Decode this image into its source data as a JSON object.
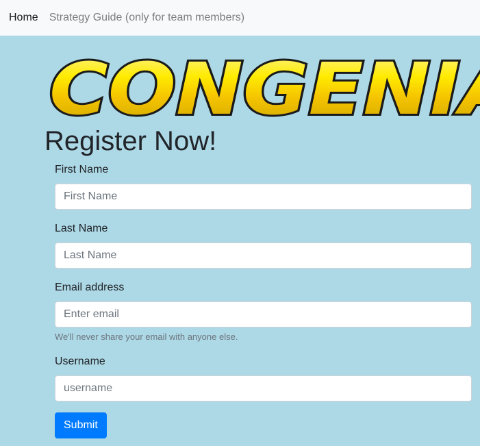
{
  "navbar": {
    "links": [
      {
        "label": "Home",
        "active": true
      },
      {
        "label": "Strategy Guide (only for team members)",
        "active": false
      }
    ]
  },
  "logo": {
    "text": "CONGENIA",
    "colors": {
      "fill_top": "#fff59d",
      "fill_mid": "#ffeb00",
      "fill_bottom": "#c9a400",
      "outline": "#1a1a1a"
    }
  },
  "page": {
    "title": "Register Now!",
    "background": "#add8e6"
  },
  "form": {
    "first_name": {
      "label": "First Name",
      "placeholder": "First Name",
      "value": ""
    },
    "last_name": {
      "label": "Last Name",
      "placeholder": "Last Name",
      "value": ""
    },
    "email": {
      "label": "Email address",
      "placeholder": "Enter email",
      "value": "",
      "help": "We'll never share your email with anyone else."
    },
    "username": {
      "label": "Username",
      "placeholder": "username",
      "value": ""
    },
    "submit_label": "Submit",
    "submit_color": "#007bff"
  }
}
